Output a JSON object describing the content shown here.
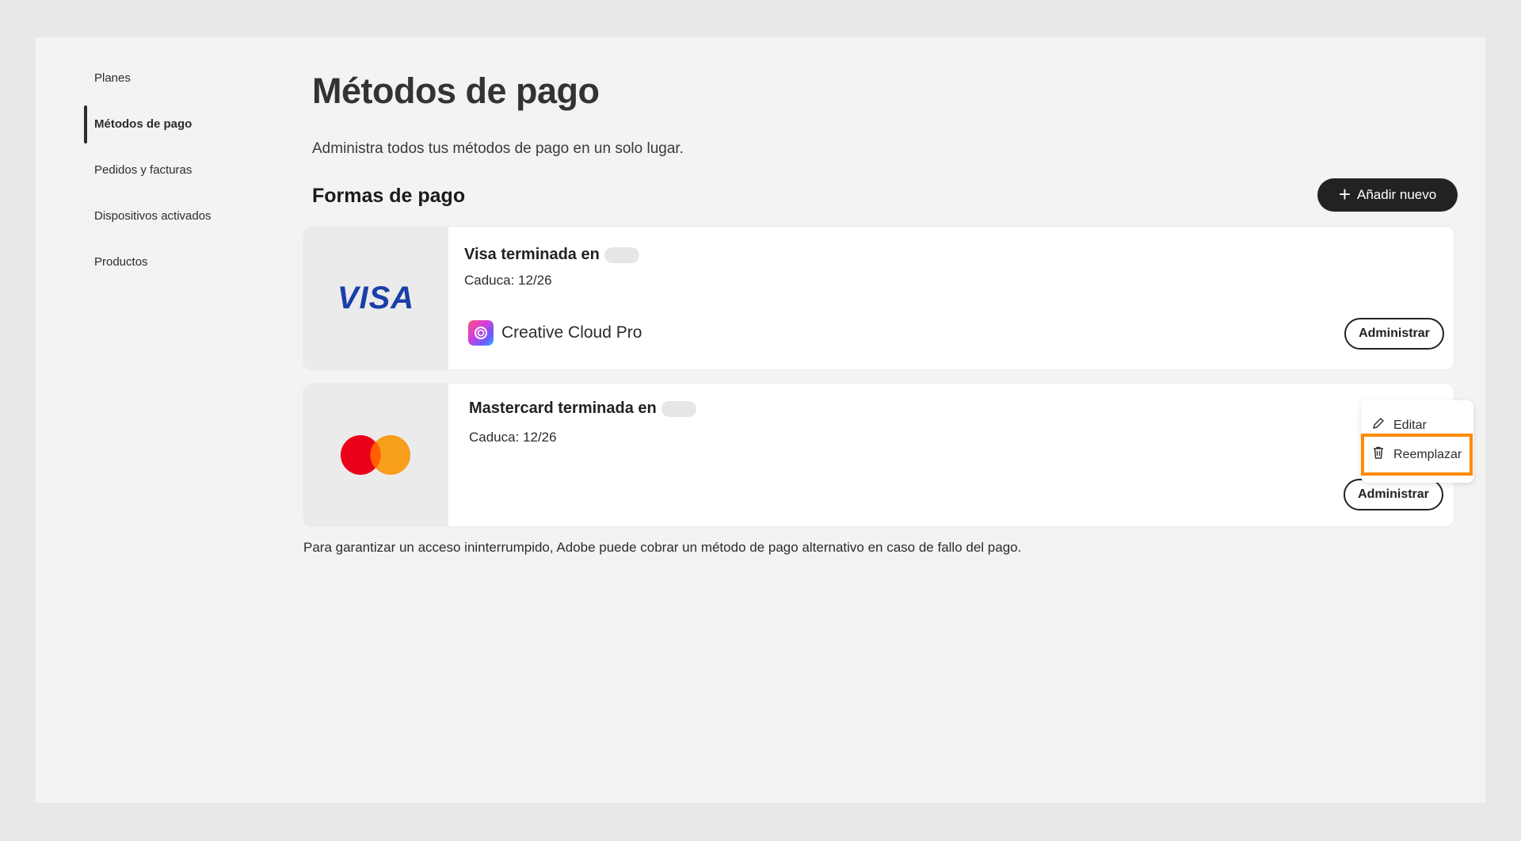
{
  "sidebar": {
    "items": [
      {
        "label": "Planes"
      },
      {
        "label": "Métodos de pago"
      },
      {
        "label": "Pedidos y facturas"
      },
      {
        "label": "Dispositivos activados"
      },
      {
        "label": "Productos"
      }
    ],
    "active_index": 1
  },
  "main": {
    "title": "Métodos de pago",
    "subtitle": "Administra todos tus métodos de pago en un solo lugar.",
    "section_title": "Formas de pago",
    "add_button_label": "Añadir nuevo",
    "cards": [
      {
        "brand_logo_text": "VISA",
        "title": "Visa terminada en",
        "expiry": "Caduca: 12/26",
        "product": "Creative Cloud Pro",
        "manage_label": "Administrar"
      },
      {
        "brand": "Mastercard",
        "title": "Mastercard terminada en",
        "expiry": "Caduca: 12/26",
        "manage_label": "Administrar"
      }
    ],
    "menu": {
      "items": [
        {
          "label": "Editar",
          "icon": "pencil-icon"
        },
        {
          "label": "Reemplazar",
          "icon": "trash-icon",
          "highlighted": true
        }
      ]
    },
    "footnote": "Para garantizar un acceso ininterrumpido, Adobe puede cobrar un método de pago alternativo en caso de fallo del pago."
  },
  "colors": {
    "accent_highlight": "#ff8a00",
    "visa_blue": "#1a3fa8",
    "mastercard_red": "#eb001b",
    "mastercard_orange": "#f79e1b",
    "button_dark": "#222222"
  }
}
